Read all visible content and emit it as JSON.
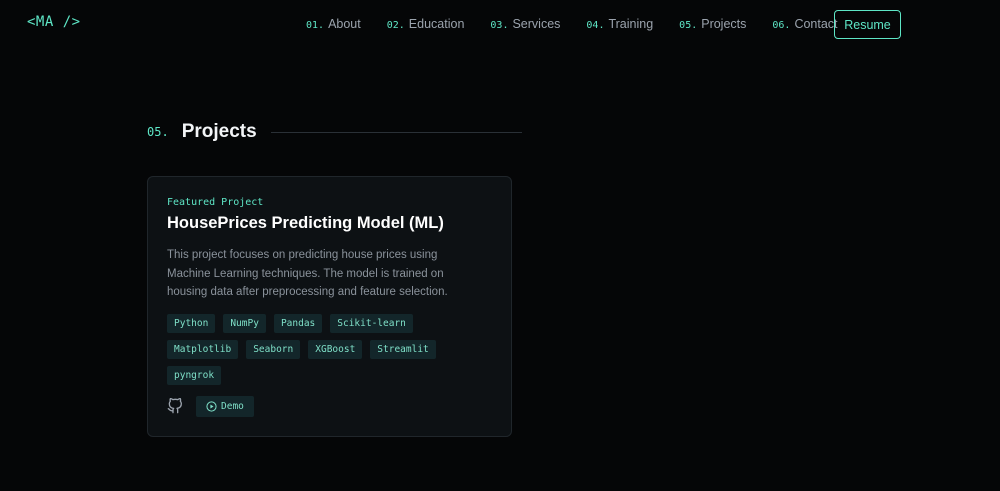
{
  "header": {
    "logo": "<MA />",
    "nav": [
      {
        "num": "01.",
        "label": "About"
      },
      {
        "num": "02.",
        "label": "Education"
      },
      {
        "num": "03.",
        "label": "Services"
      },
      {
        "num": "04.",
        "label": "Training"
      },
      {
        "num": "05.",
        "label": "Projects"
      },
      {
        "num": "06.",
        "label": "Contact"
      }
    ],
    "resume_label": "Resume"
  },
  "section": {
    "num": "05.",
    "title": "Projects"
  },
  "project": {
    "badge": "Featured Project",
    "title": "HousePrices Predicting Model (ML)",
    "description": "This project focuses on predicting house prices using Machine Learning techniques. The model is trained on housing data after preprocessing and feature selection.",
    "tags": [
      "Python",
      "NumPy",
      "Pandas",
      "Scikit-learn",
      "Matplotlib",
      "Seaborn",
      "XGBoost",
      "Streamlit",
      "pyngrok"
    ],
    "github_icon": "github-icon",
    "demo_icon": "play-icon",
    "demo_label": "Demo"
  },
  "colors": {
    "accent": "#5ee6c6",
    "background": "#050607",
    "card": "#0d1114",
    "tag_bg": "#13262a"
  }
}
